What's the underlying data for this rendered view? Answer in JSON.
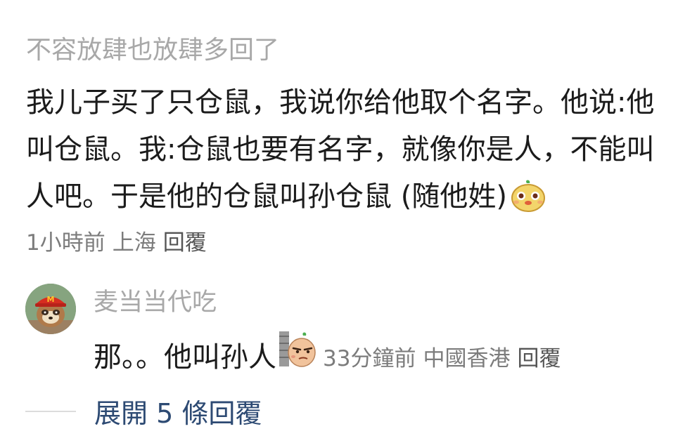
{
  "comment": {
    "username": "不容放肆也放肆多回了",
    "text": "我儿子买了只仓鼠，我说你给他取个名字。他说:他叫仓鼠。我:仓鼠也要有名字，就像你是人，不能叫人吧。于是他的仓鼠叫孙仓鼠 (随他姓)",
    "emoji_icon": "hamster-face-emoji",
    "time": "1小時前",
    "location": "上海",
    "reply_label": "回覆"
  },
  "reply": {
    "username": "麦当当代吃",
    "avatar_icon": "raccoon-mcdonalds-cap-avatar",
    "text": "那。。他叫孙人",
    "emoji_icon": "peeking-behind-wall-emoji",
    "time": "33分鐘前",
    "location": "中國香港",
    "reply_label": "回覆"
  },
  "expand": {
    "label": "展開 5 條回覆"
  },
  "colors": {
    "username": "#a8a8a8",
    "text": "#1b1b1b",
    "meta": "#7c7c7c",
    "expand_link": "#2d4a73"
  }
}
